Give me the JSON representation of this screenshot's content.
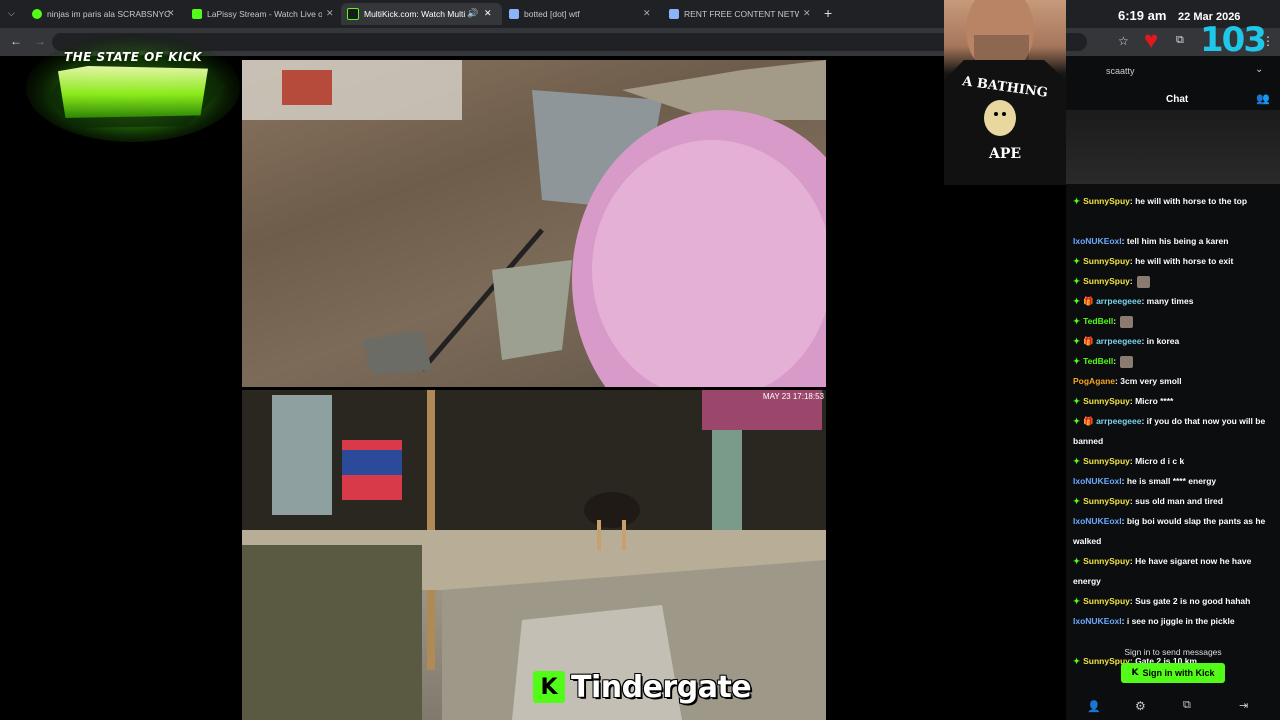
{
  "browser": {
    "tabs": [
      {
        "label": "ninjas im paris ala SCRABSNYC",
        "icon": "kick-icon",
        "color": "#53fc18"
      },
      {
        "label": "LaPissy Stream - Watch Live on",
        "icon": "kick-icon",
        "color": "#53fc18"
      },
      {
        "label": "MultiKick.com: Watch Multi",
        "icon": "multikick-icon",
        "color": "#53fc18"
      },
      {
        "label": "botted [dot] wtf",
        "icon": "page-icon",
        "color": "#8ab4f8"
      },
      {
        "label": "RENT FREE CONTENT NETWOR",
        "icon": "page-icon",
        "color": "#8ab4f8"
      }
    ],
    "new_tab": "+"
  },
  "overlay": {
    "logo_text": "THE STATE OF KICK",
    "time": "6:19 am",
    "date": "22 Mar 2026",
    "viewer_count": "103",
    "shirt_text_top": "A BATHING",
    "shirt_text_bottom": "APE"
  },
  "video": {
    "bottom_timestamp": "MAY 23 17:18:53",
    "caption": "Tindergate"
  },
  "chat": {
    "channel": "scaatty",
    "title": "Chat",
    "messages": [
      {
        "user": "SunnySpuy",
        "user_color": "#f0e442",
        "badge": true,
        "gift": false,
        "text": "he will with horse to the top"
      },
      {
        "user": "IxoNUKEoxI",
        "user_color": "#6fa8ff",
        "badge": false,
        "gift": false,
        "text": "tell him his being a karen"
      },
      {
        "user": "SunnySpuy",
        "user_color": "#f0e442",
        "badge": true,
        "gift": false,
        "text": "he will with horse to exit"
      },
      {
        "user": "SunnySpuy",
        "user_color": "#f0e442",
        "badge": true,
        "gift": false,
        "text": ""
      },
      {
        "user": "arrpeegeee",
        "user_color": "#7dd3f0",
        "badge": true,
        "gift": true,
        "text": "many times"
      },
      {
        "user": "TedBell",
        "user_color": "#53fc18",
        "badge": true,
        "gift": false,
        "text": ""
      },
      {
        "user": "arrpeegeee",
        "user_color": "#7dd3f0",
        "badge": true,
        "gift": true,
        "text": "in korea"
      },
      {
        "user": "TedBell",
        "user_color": "#53fc18",
        "badge": true,
        "gift": false,
        "text": ""
      },
      {
        "user": "PogAgane",
        "user_color": "#f5a623",
        "badge": false,
        "gift": false,
        "text": "3cm very smoll"
      },
      {
        "user": "SunnySpuy",
        "user_color": "#f0e442",
        "badge": true,
        "gift": false,
        "text": "Micro ****"
      },
      {
        "user": "arrpeegeee",
        "user_color": "#7dd3f0",
        "badge": true,
        "gift": true,
        "text": "if you do that now you will be banned"
      },
      {
        "user": "SunnySpuy",
        "user_color": "#f0e442",
        "badge": true,
        "gift": false,
        "text": "Micro d i c k"
      },
      {
        "user": "IxoNUKEoxI",
        "user_color": "#6fa8ff",
        "badge": false,
        "gift": false,
        "text": "he is small **** energy"
      },
      {
        "user": "SunnySpuy",
        "user_color": "#f0e442",
        "badge": true,
        "gift": false,
        "text": "sus old man and tired"
      },
      {
        "user": "IxoNUKEoxI",
        "user_color": "#6fa8ff",
        "badge": false,
        "gift": false,
        "text": "big boi would slap the pants as he walked"
      },
      {
        "user": "SunnySpuy",
        "user_color": "#f0e442",
        "badge": true,
        "gift": false,
        "text": "He have sigaret now he have energy"
      },
      {
        "user": "SunnySpuy",
        "user_color": "#f0e442",
        "badge": true,
        "gift": false,
        "text": "Sus gate 2 is no good hahah"
      },
      {
        "user": "IxoNUKEoxI",
        "user_color": "#6fa8ff",
        "badge": false,
        "gift": false,
        "text": "i see no jiggle in the pickle"
      },
      {
        "user": "SunnySpuy",
        "user_color": "#f0e442",
        "badge": true,
        "gift": false,
        "text": "Gate 2 is 10 km"
      }
    ],
    "sign_in_prompt": "Sign in to send messages",
    "sign_in_button": "Sign in with Kick",
    "accent": "#53fc18"
  }
}
